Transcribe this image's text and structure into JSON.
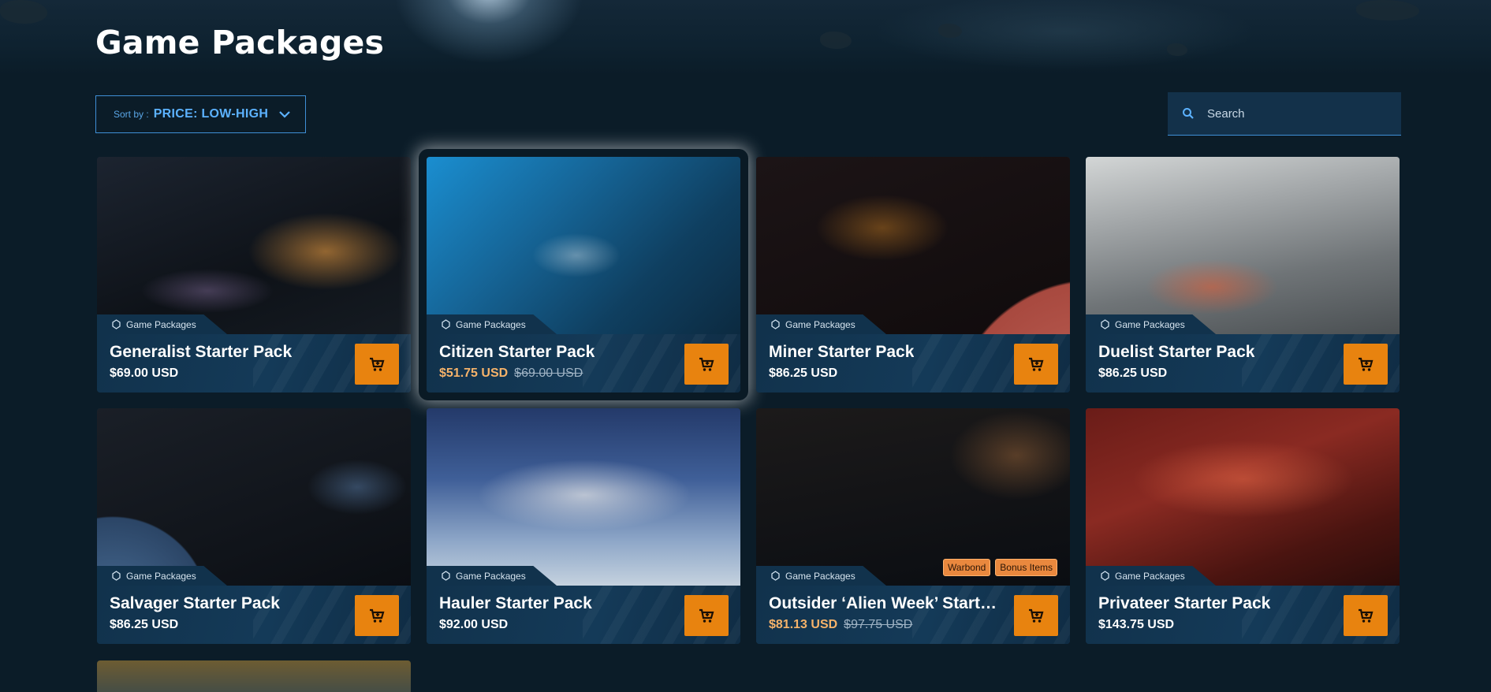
{
  "page": {
    "title": "Game Packages"
  },
  "sort": {
    "label": "Sort by :",
    "value": "PRICE: LOW-HIGH"
  },
  "search": {
    "placeholder": "Search"
  },
  "colors": {
    "accent": "#3f8fd6",
    "cart": "#e8830f",
    "sale": "#f6b36a",
    "badge": "#e9883e",
    "background": "#0b1c28"
  },
  "cards": [
    {
      "name": "Generalist Starter Pack",
      "category": "Game Packages",
      "price": "$69.00 USD",
      "old_price": null,
      "badges": []
    },
    {
      "name": "Citizen Starter Pack",
      "category": "Game Packages",
      "price": "$51.75 USD",
      "old_price": "$69.00 USD",
      "badges": []
    },
    {
      "name": "Miner Starter Pack",
      "category": "Game Packages",
      "price": "$86.25 USD",
      "old_price": null,
      "badges": []
    },
    {
      "name": "Duelist Starter Pack",
      "category": "Game Packages",
      "price": "$86.25 USD",
      "old_price": null,
      "badges": []
    },
    {
      "name": "Salvager Starter Pack",
      "category": "Game Packages",
      "price": "$86.25 USD",
      "old_price": null,
      "badges": []
    },
    {
      "name": "Hauler Starter Pack",
      "category": "Game Packages",
      "price": "$92.00 USD",
      "old_price": null,
      "badges": []
    },
    {
      "name": "Outsider ‘Alien Week’ Starter ...",
      "category": "Game Packages",
      "price": "$81.13 USD",
      "old_price": "$97.75 USD",
      "badges": [
        "Warbond",
        "Bonus Items"
      ]
    },
    {
      "name": "Privateer Starter Pack",
      "category": "Game Packages",
      "price": "$143.75 USD",
      "old_price": null,
      "badges": []
    }
  ]
}
